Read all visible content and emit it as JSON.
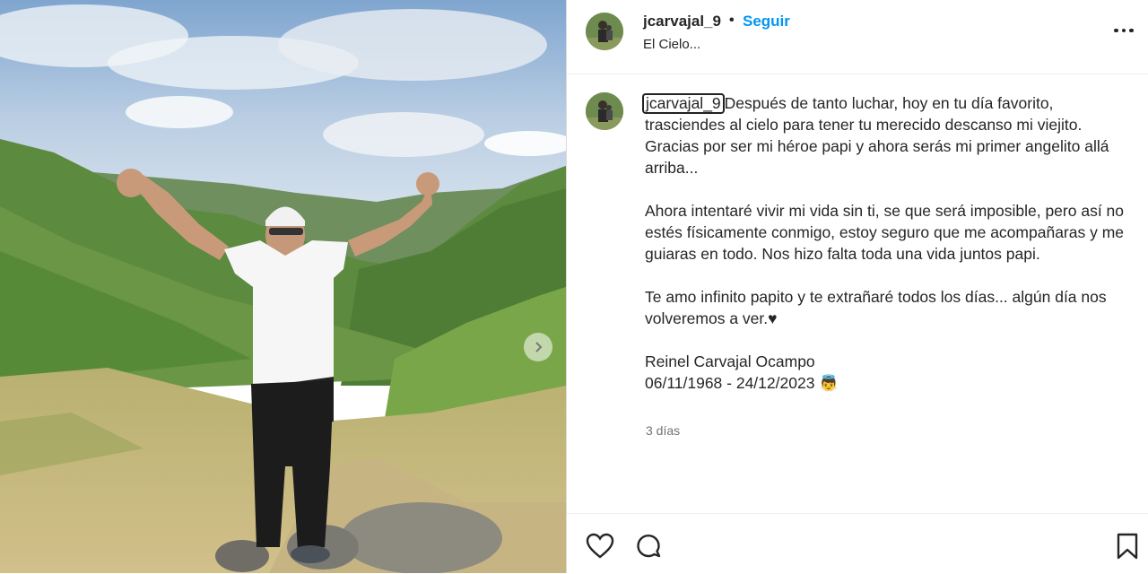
{
  "post": {
    "username": "jcarvajal_9",
    "separator": "•",
    "follow_label": "Seguir",
    "location": "El Cielo...",
    "caption_username": "jcarvajal_9",
    "caption_p1": "Después de tanto luchar, hoy en tu día favorito, trasciendes al cielo para tener tu merecido descanso mi viejito. Gracias por ser mi héroe papi y ahora serás mi primer angelito allá arriba...",
    "caption_p2": "Ahora intentaré vivir mi vida sin ti, se que será imposible, pero así no estés físicamente conmigo, estoy seguro que me acompañaras y me guiaras en todo. Nos hizo falta toda una vida juntos papi.",
    "caption_p3": "Te amo infinito papito y te extrañaré todos los días... algún día nos volveremos a ver.♥",
    "caption_name": "Reinel Carvajal Ocampo",
    "caption_dates": "06/11/1968 - 24/12/2023",
    "caption_emoji": "👼",
    "time_ago": "3 días"
  },
  "icons": {
    "more": "more-options-icon",
    "like": "heart-icon",
    "comment": "comment-icon",
    "save": "bookmark-icon",
    "next": "chevron-right-icon"
  },
  "colors": {
    "follow": "#0095f6",
    "text": "#262626",
    "muted": "#737373"
  }
}
